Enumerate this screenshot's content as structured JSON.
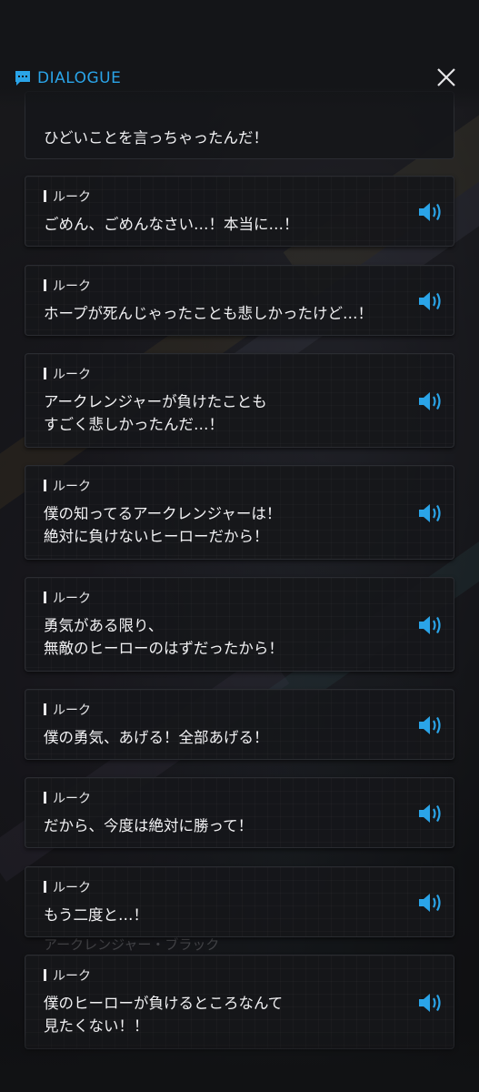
{
  "header": {
    "title": "DIALOGUE",
    "icon": "chat-icon",
    "accent_color": "#2aa4e8"
  },
  "partial_entry": {
    "text": "ひどいことを言っちゃったんだ！"
  },
  "entries": [
    {
      "speaker": "ルーク",
      "text": "ごめん、ごめんなさい…！本当に…！"
    },
    {
      "speaker": "ルーク",
      "text": "ホープが死んじゃったことも悲しかったけど…！"
    },
    {
      "speaker": "ルーク",
      "text": "アークレンジャーが負けたことも\nすごく悲しかったんだ…！"
    },
    {
      "speaker": "ルーク",
      "text": "僕の知ってるアークレンジャーは！\n絶対に負けないヒーローだから！"
    },
    {
      "speaker": "ルーク",
      "text": "勇気がある限り、\n無敵のヒーローのはずだったから！"
    },
    {
      "speaker": "ルーク",
      "text": "僕の勇気、あげる！全部あげる！"
    },
    {
      "speaker": "ルーク",
      "text": "だから、今度は絶対に勝って！"
    },
    {
      "speaker": "ルーク",
      "text": "もう二度と…！"
    },
    {
      "speaker": "ルーク",
      "text": "僕のヒーローが負けるところなんて\n見たくない！！"
    }
  ],
  "background_text": "アークレンジャー・ブラック",
  "voice_icon": "speaker-icon"
}
